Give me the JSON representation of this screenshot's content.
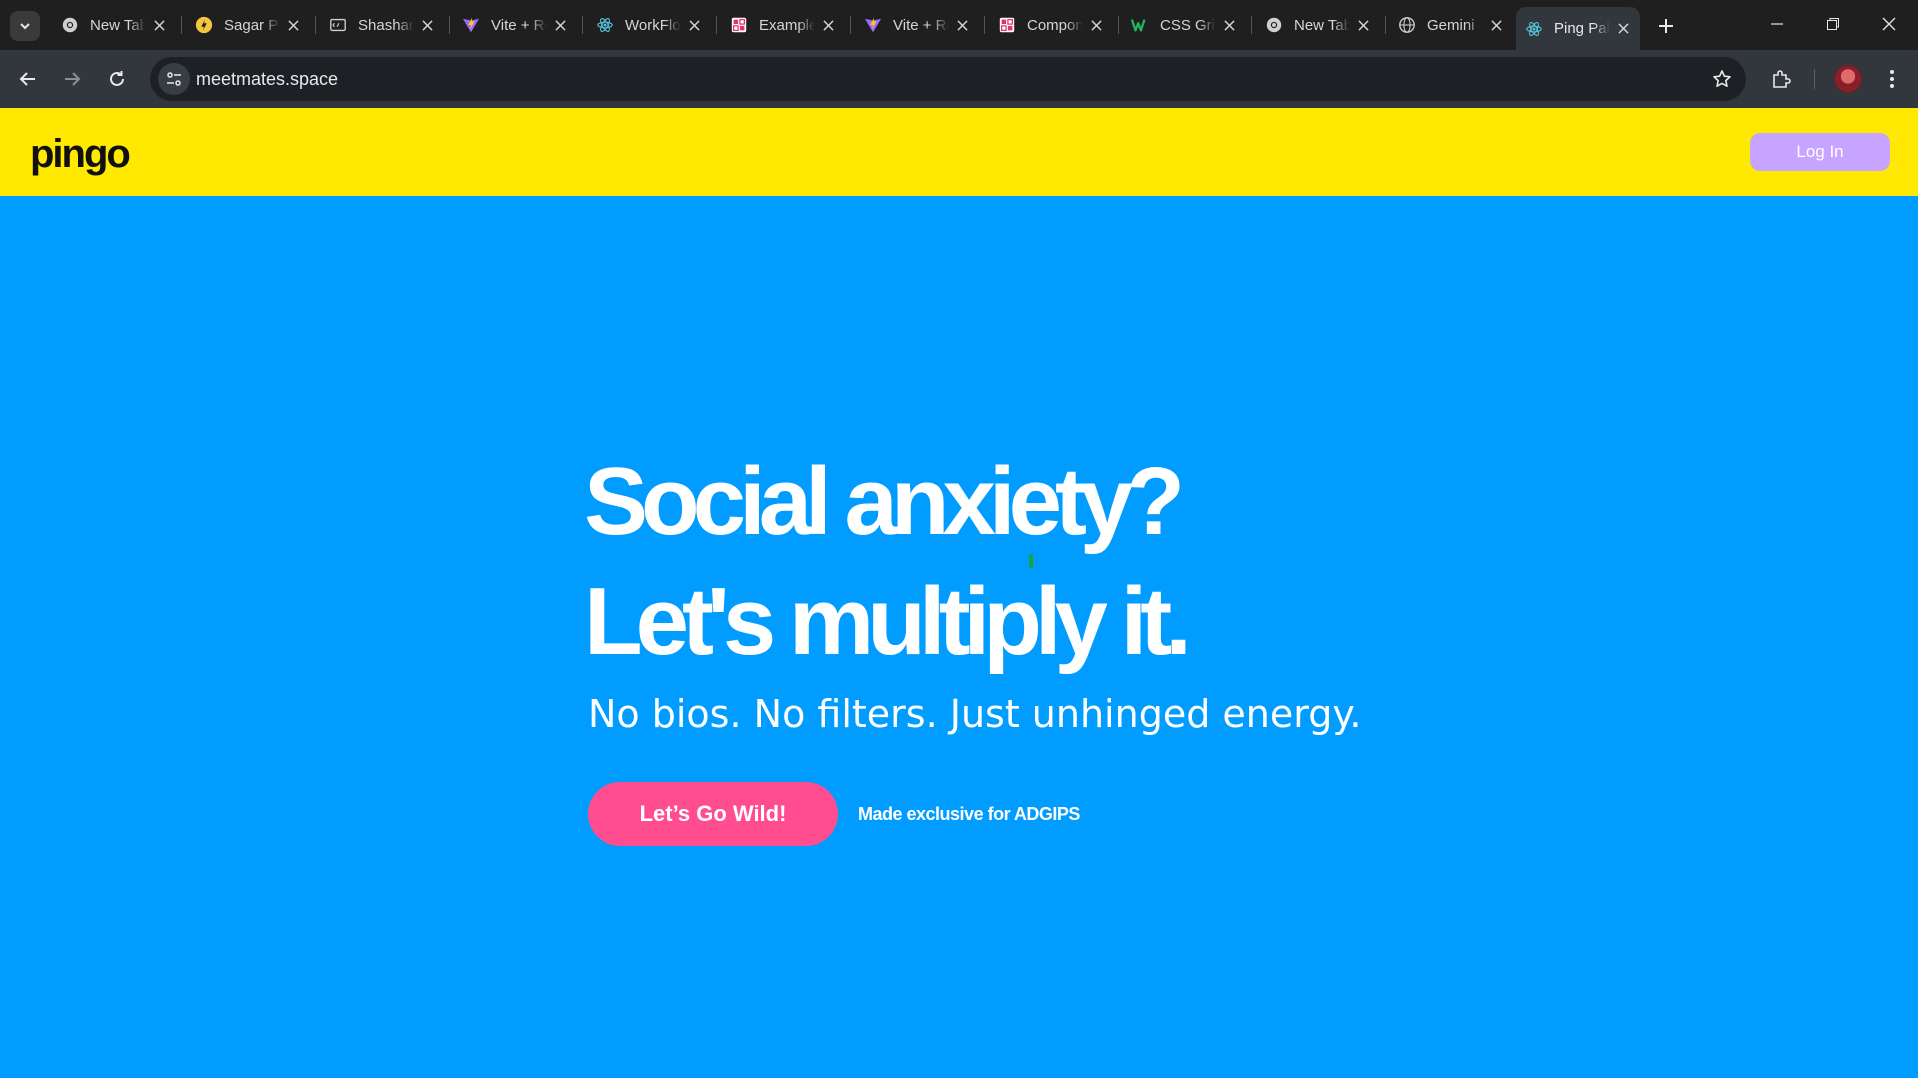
{
  "browser": {
    "tabs": [
      {
        "title": "New Tab",
        "icon": "chrome-icon"
      },
      {
        "title": "Sagar Portfolio",
        "icon": "sagar-favicon-icon"
      },
      {
        "title": "Shashank",
        "icon": "code-window-icon"
      },
      {
        "title": "Vite + React",
        "icon": "vite-icon"
      },
      {
        "title": "WorkFlow",
        "icon": "react-icon"
      },
      {
        "title": "Examples",
        "icon": "grid-app-icon"
      },
      {
        "title": "Vite + React",
        "icon": "vite-icon"
      },
      {
        "title": "Components",
        "icon": "grid-app-icon"
      },
      {
        "title": "CSS Grid",
        "icon": "w-logo-icon"
      },
      {
        "title": "New Tab",
        "icon": "chrome-icon"
      },
      {
        "title": "Gemini",
        "icon": "globe-icon"
      },
      {
        "title": "Ping Pals",
        "icon": "react-icon",
        "active": true
      }
    ],
    "url": "meetmates.space"
  },
  "header": {
    "logo": "pingo",
    "login_label": "Log In"
  },
  "hero": {
    "line1": "Social anxiety?",
    "line2": "Let's multiply it.",
    "subtitle": "No bios. No filters. Just unhinged energy.",
    "cta_label": "Let’s Go Wild!",
    "note": "Made exclusive for ADGIPS"
  },
  "colors": {
    "header_bg": "#ffe900",
    "hero_bg": "#009cff",
    "cta_bg": "#ff4d8f",
    "login_bg": "#c6a4ff"
  }
}
